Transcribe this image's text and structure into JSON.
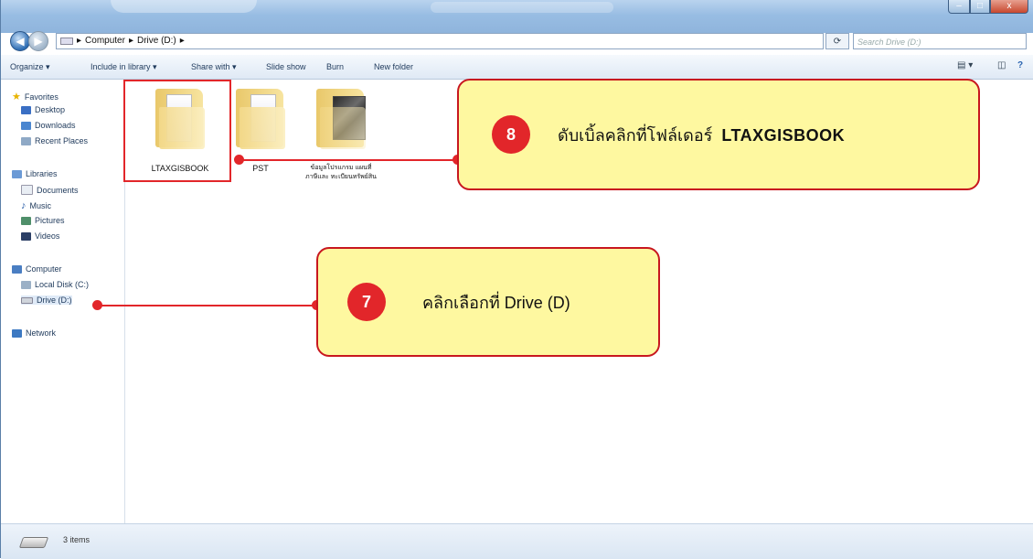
{
  "address": {
    "segments": [
      "Computer",
      "Drive (D:)"
    ],
    "separator": "▸",
    "search_placeholder": "Search Drive (D:)",
    "refresh_label": "⟳"
  },
  "toolbar": {
    "organize": "Organize ▾",
    "include": "Include in library ▾",
    "share": "Share with ▾",
    "slideshow": "Slide show",
    "burn": "Burn",
    "newfolder": "New folder"
  },
  "sidebar": {
    "favorites": "Favorites",
    "desktop": "Desktop",
    "downloads": "Downloads",
    "recent": "Recent Places",
    "libraries": "Libraries",
    "documents": "Documents",
    "music": "Music",
    "pictures": "Pictures",
    "videos": "Videos",
    "computer": "Computer",
    "localdisk": "Local Disk (C:)",
    "drive_d": "Drive (D:)",
    "network": "Network"
  },
  "folders": [
    {
      "name": "LTAXGISBOOK"
    },
    {
      "name": "PST"
    },
    {
      "name": "ข้อมูลโปรแกรม แผนที่ภาษีและ ทะเบียนทรัพย์สิน"
    }
  ],
  "status": {
    "items": "3 items"
  },
  "callouts": {
    "step8": {
      "number": "8",
      "text": "ดับเบิ้ลคลิกที่โฟล์เดอร์",
      "bold": "LTAXGISBOOK"
    },
    "step7": {
      "number": "7",
      "text": "คลิกเลือกที่ Drive (D)"
    }
  },
  "colors": {
    "accent_red": "#e2262a",
    "callout_bg": "#fef8a0"
  }
}
